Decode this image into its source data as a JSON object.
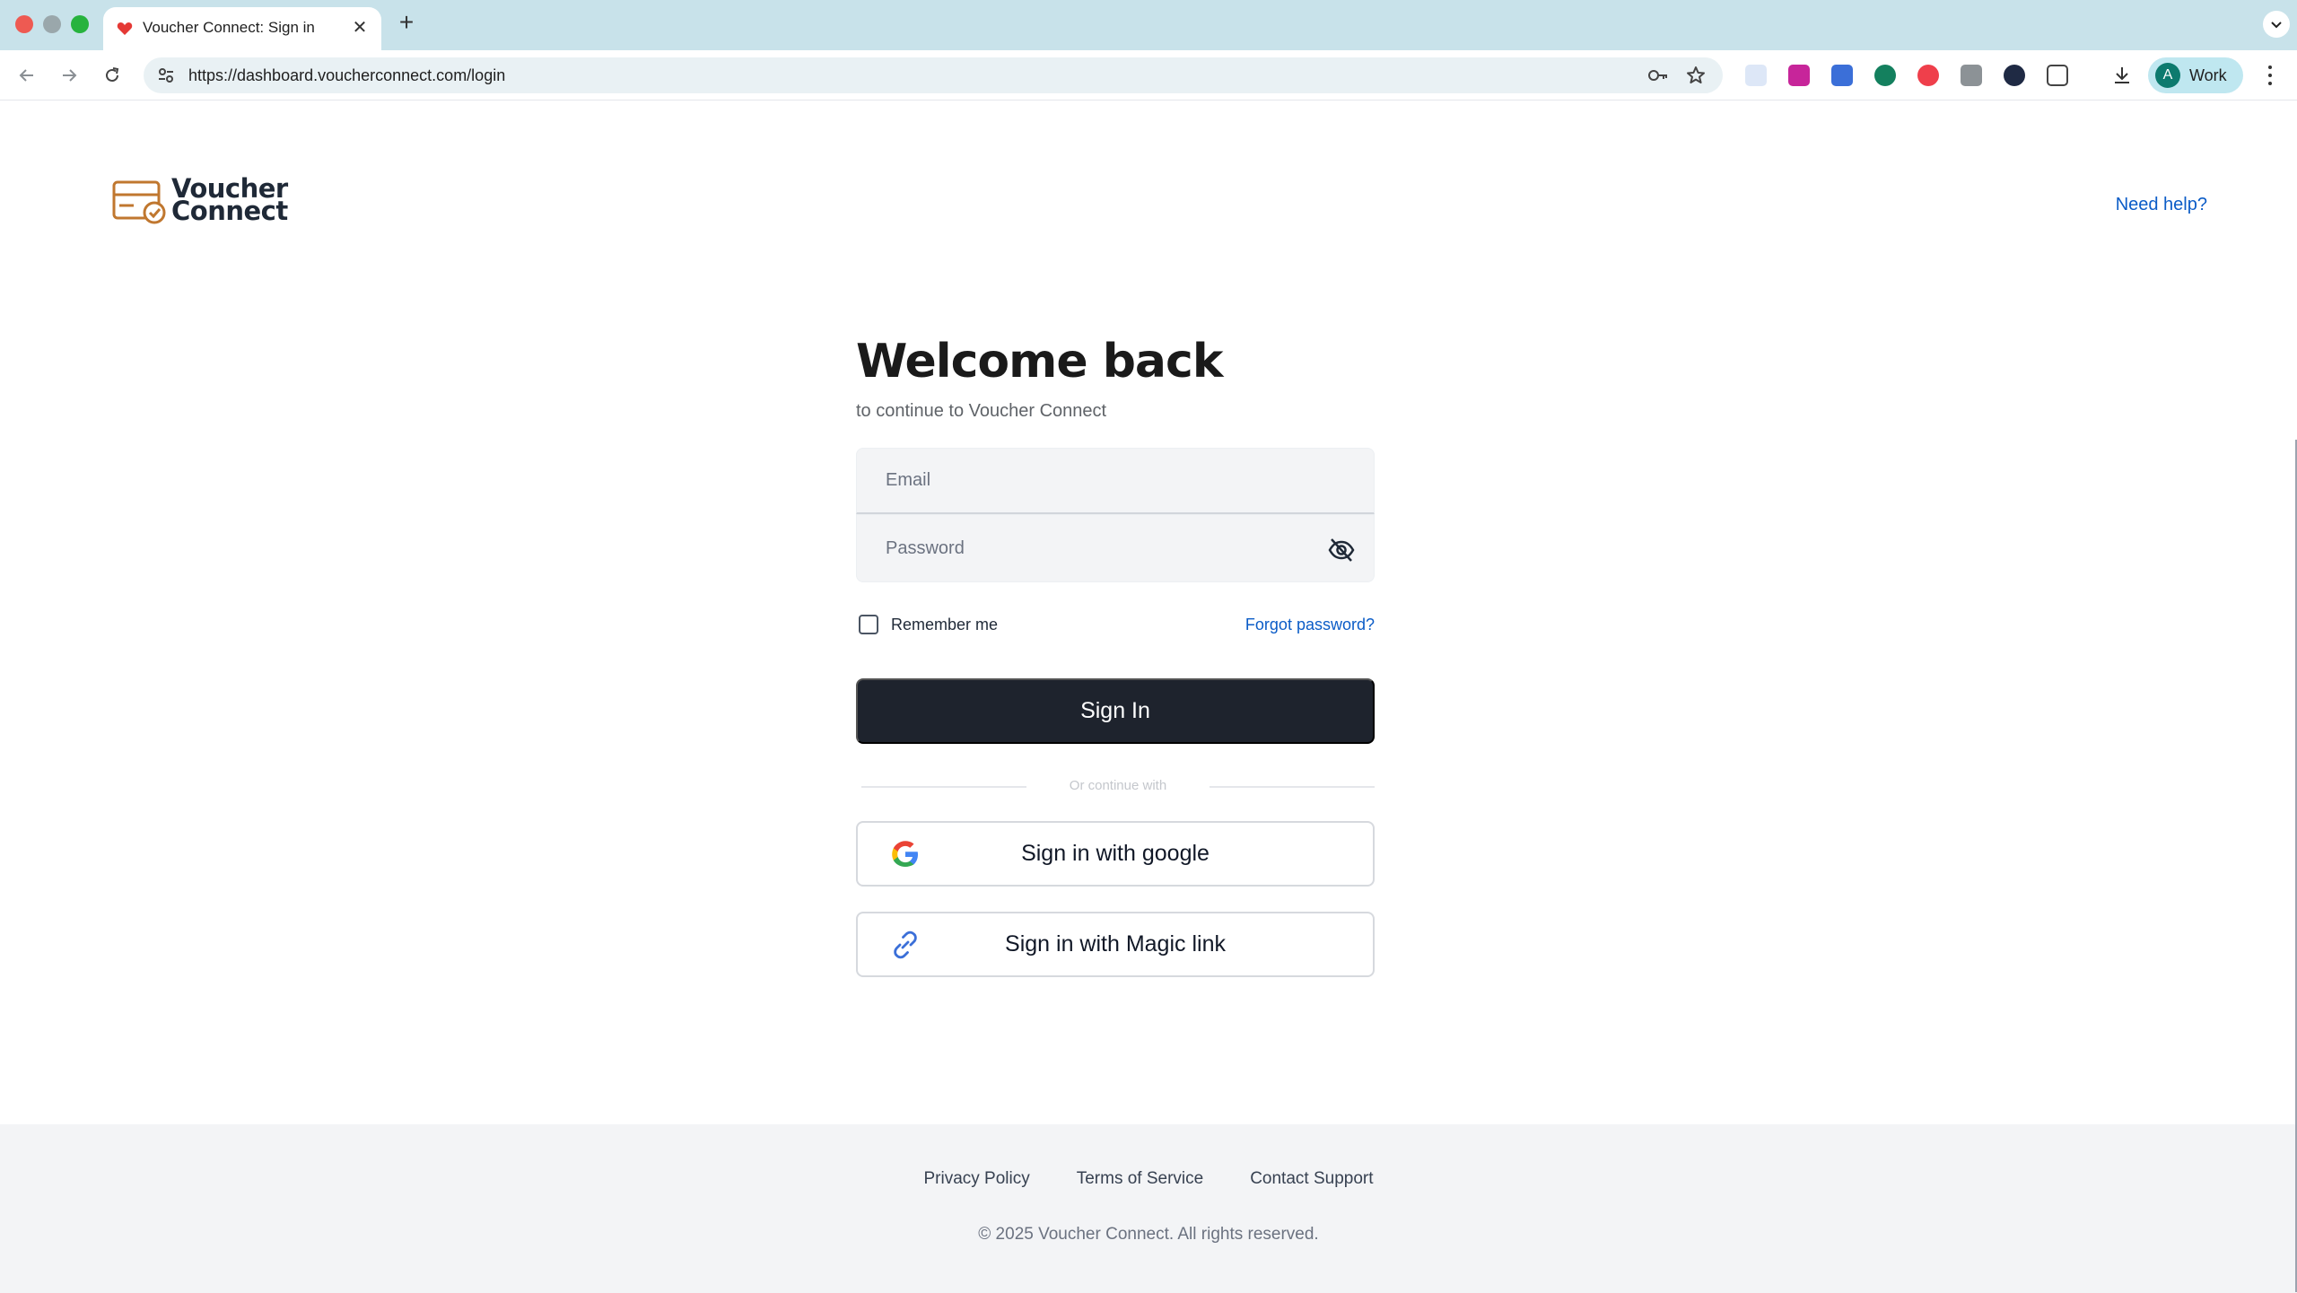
{
  "browser": {
    "tab_title": "Voucher Connect: Sign in",
    "new_tab_symbol": "+",
    "url": "https://dashboard.voucherconnect.com/login",
    "profile": {
      "initial": "A",
      "label": "Work"
    }
  },
  "header": {
    "logo_line1": "Voucher",
    "logo_line2": "Connect",
    "need_help": "Need help?"
  },
  "login": {
    "title": "Welcome back",
    "subtitle": "to continue to Voucher Connect",
    "email_placeholder": "Email",
    "password_placeholder": "Password",
    "remember_me": "Remember me",
    "forgot_password": "Forgot password?",
    "sign_in": "Sign In",
    "divider_text": "Or continue with",
    "google_button": "Sign in with google",
    "magic_button": "Sign in with Magic link"
  },
  "footer": {
    "links": [
      "Privacy Policy",
      "Terms of Service",
      "Contact Support"
    ],
    "copyright": "© 2025 Voucher Connect. All rights reserved."
  },
  "colors": {
    "brand_orange": "#c0772f",
    "link_blue": "#0b5cc7",
    "primary_button": "#1e232d",
    "chrome_tabbar": "#c8e2ea"
  }
}
